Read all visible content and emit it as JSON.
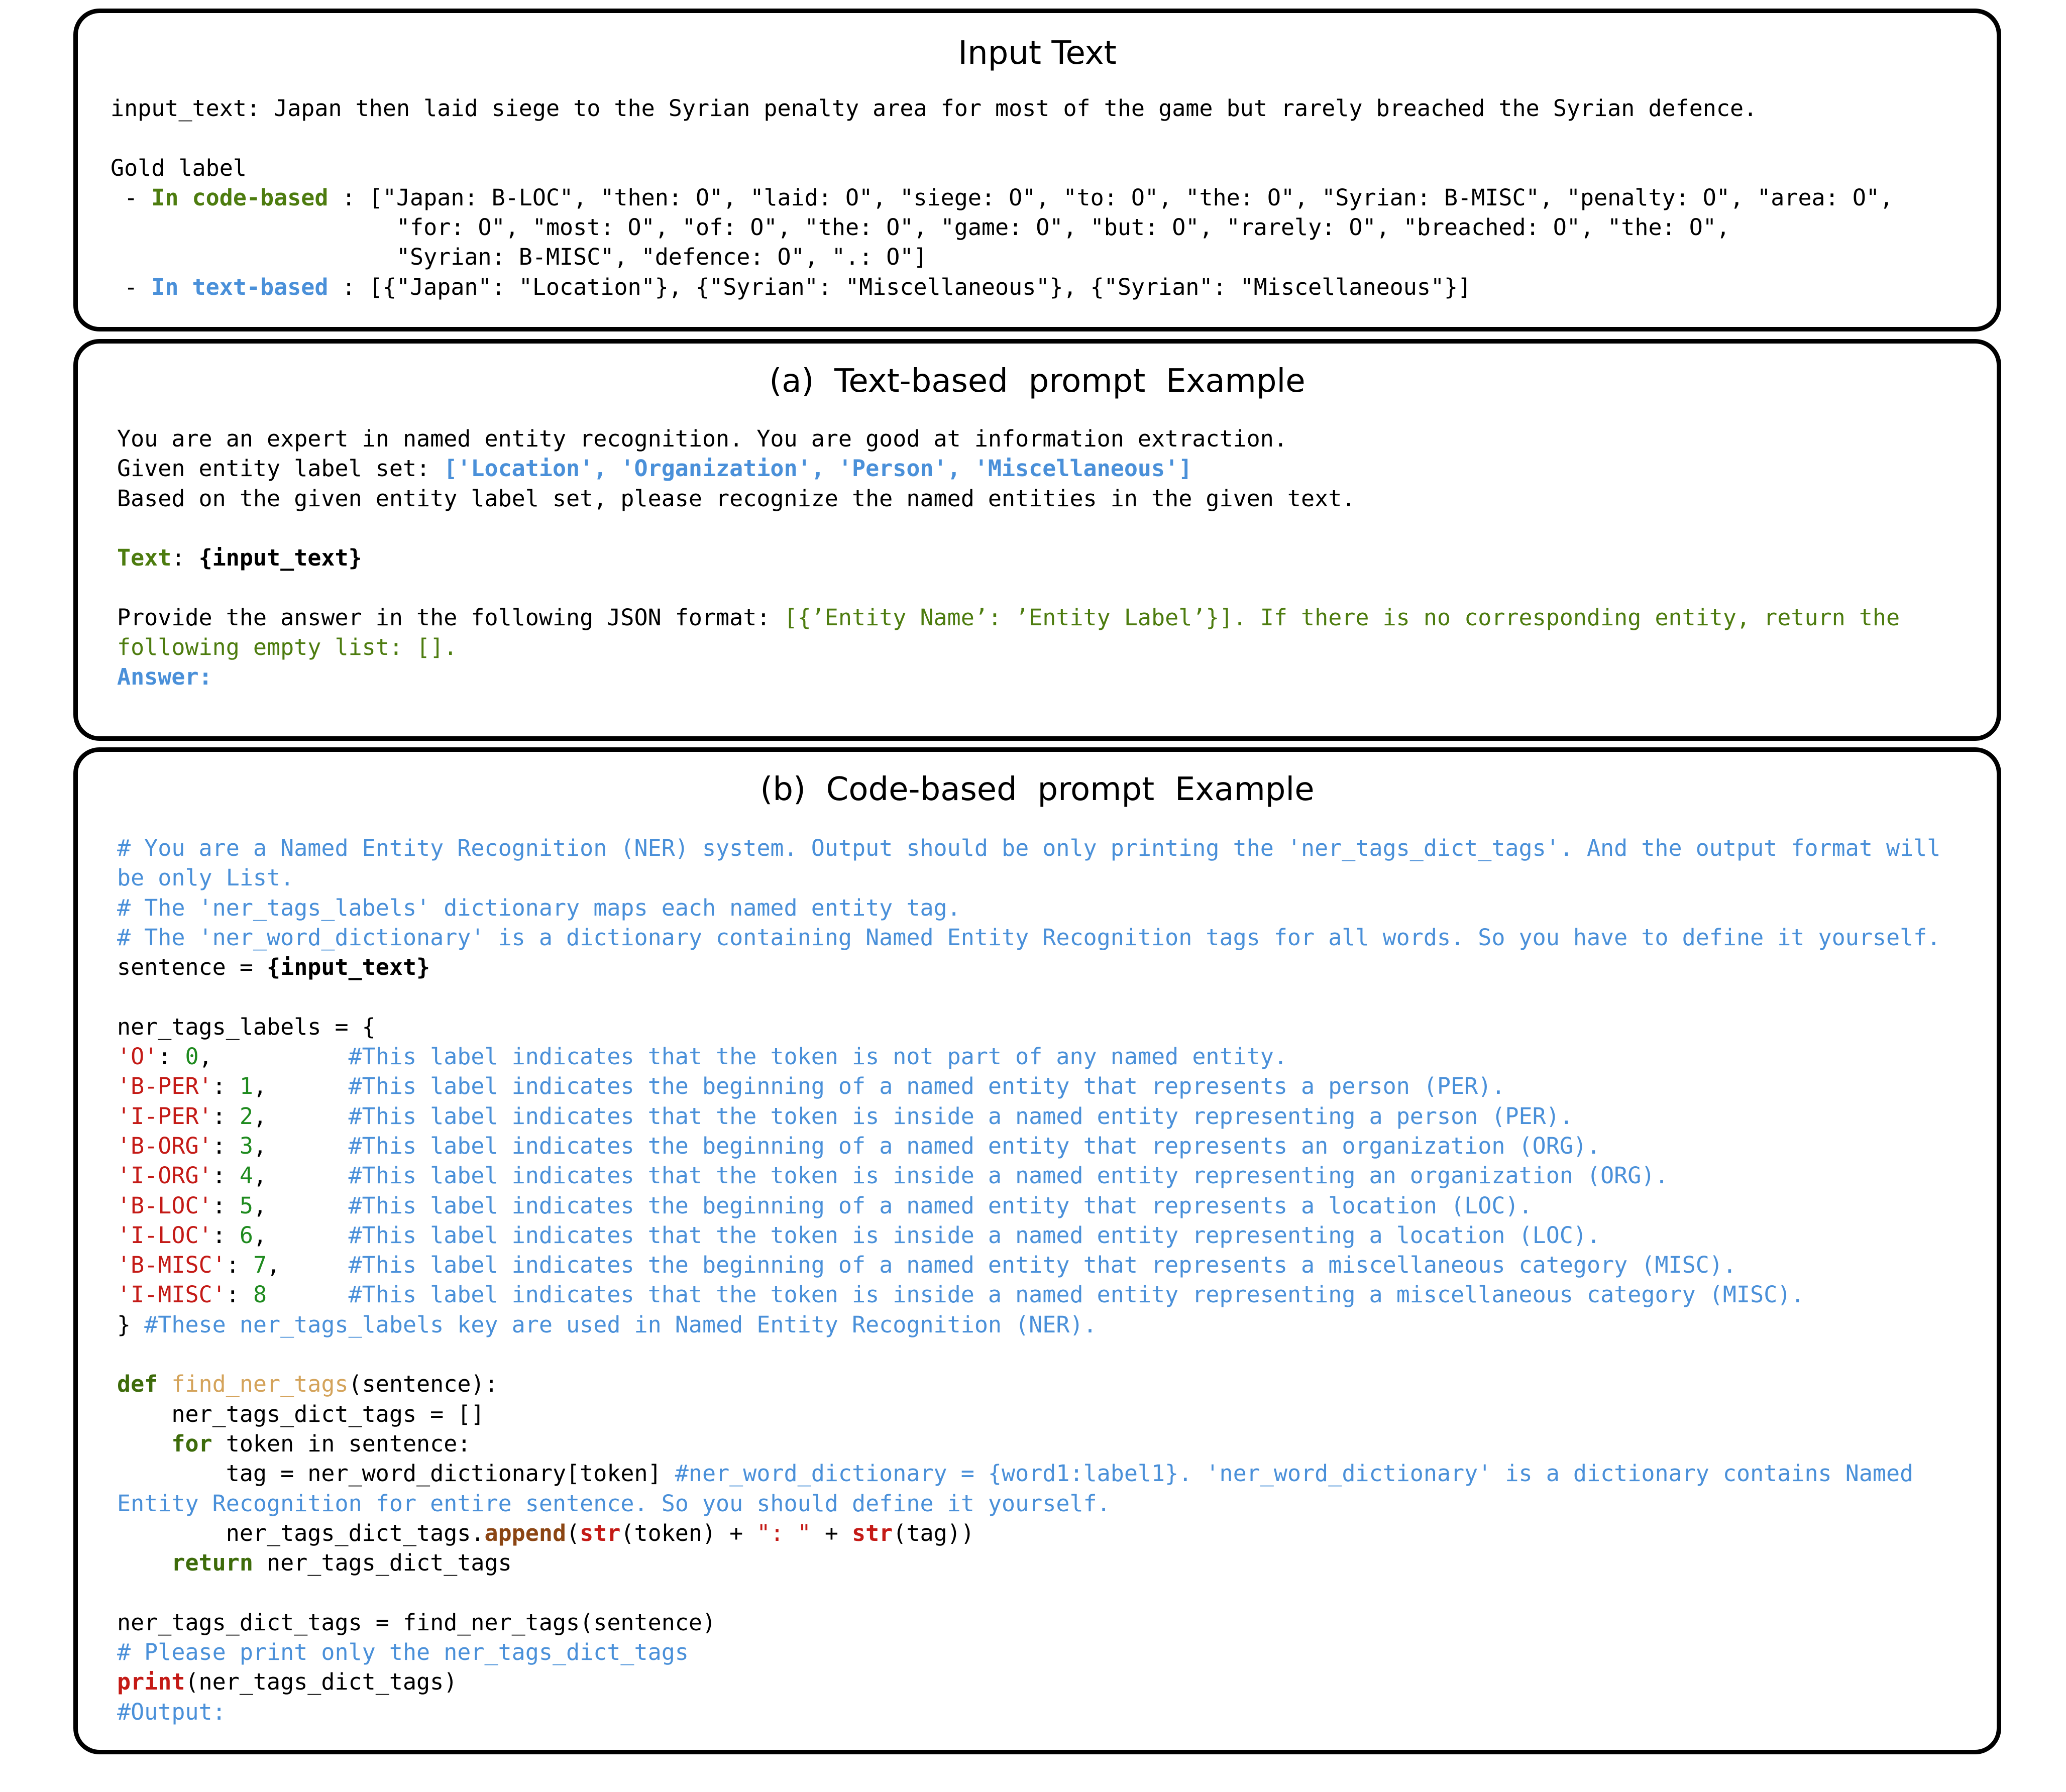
{
  "input_panel": {
    "title": "Input Text",
    "input_text_label": "input_text:",
    "input_text_value": "Japan then laid siege to the Syrian penalty area for most of the game but rarely breached the Syrian defence.",
    "gold_label": "Gold label",
    "code_bullet_dash": " - ",
    "code_based_label": "In code-based",
    "code_tags_line1": " : [\"Japan: B-LOC\", \"then: O\", \"laid: O\", \"siege: O\", \"to: O\", \"the: O\", \"Syrian: B-MISC\", \"penalty: O\", \"area: O\",",
    "code_tags_line2": "\"for: O\", \"most: O\", \"of: O\", \"the: O\", \"game: O\", \"but: O\", \"rarely: O\", \"breached: O\", \"the: O\",",
    "code_tags_line3": "\"Syrian: B-MISC\", \"defence: O\", \".: O\"]",
    "text_bullet_dash": " - ",
    "text_based_label": "In text-based",
    "text_tags": " : [{\"Japan\": \"Location\"}, {\"Syrian\": \"Miscellaneous\"}, {\"Syrian\": \"Miscellaneous\"}]"
  },
  "text_prompt_panel": {
    "title": "(a)  Text-based  prompt  Example",
    "line1": "You are an expert in named entity recognition. You are good at information extraction.",
    "line2_prefix": "Given entity label set: ",
    "label_set": "['Location', 'Organization', 'Person', 'Miscellaneous']",
    "line3": "Based on the given entity label set, please recognize the named entities in the given text.",
    "text_key": "Text",
    "text_colon": ": ",
    "text_placeholder": "{input_text}",
    "format_prefix": "Provide the answer in the following JSON format: ",
    "format_line1_rest": "[{’Entity Name’: ’Entity Label’}]. If there is no corresponding entity, return the",
    "format_line2": "following empty list: [].",
    "answer_label": "Answer:"
  },
  "code_prompt_panel": {
    "title": "(b)  Code-based  prompt  Example",
    "comment1a": "# You are a Named Entity Recognition (NER) system. Output should be only printing the 'ner_tags_dict_tags'. And the output format will",
    "comment1b": "be only List.",
    "comment2": "# The 'ner_tags_labels' dictionary maps each named entity tag.",
    "comment3": "# The 'ner_word_dictionary' is a dictionary containing Named Entity Recognition tags for all words. So you have to define it yourself.",
    "sentence_prefix": "sentence = ",
    "sentence_placeholder": "{input_text}",
    "dict_open": "ner_tags_labels = {",
    "labels": [
      {
        "key": "'O'",
        "sep": ": ",
        "val": "0",
        "after": ",",
        "pad": "          ",
        "comment": "#This label indicates that the token is not part of any named entity."
      },
      {
        "key": "'B-PER'",
        "sep": ": ",
        "val": "1",
        "after": ",",
        "pad": "      ",
        "comment": "#This label indicates the beginning of a named entity that represents a person (PER)."
      },
      {
        "key": "'I-PER'",
        "sep": ": ",
        "val": "2",
        "after": ",",
        "pad": "      ",
        "comment": "#This label indicates that the token is inside a named entity representing a person (PER)."
      },
      {
        "key": "'B-ORG'",
        "sep": ": ",
        "val": "3",
        "after": ",",
        "pad": "      ",
        "comment": "#This label indicates the beginning of a named entity that represents an organization (ORG)."
      },
      {
        "key": "'I-ORG'",
        "sep": ": ",
        "val": "4",
        "after": ",",
        "pad": "      ",
        "comment": "#This label indicates that the token is inside a named entity representing an organization (ORG)."
      },
      {
        "key": "'B-LOC'",
        "sep": ": ",
        "val": "5",
        "after": ",",
        "pad": "      ",
        "comment": "#This label indicates the beginning of a named entity that represents a location (LOC)."
      },
      {
        "key": "'I-LOC'",
        "sep": ": ",
        "val": "6",
        "after": ",",
        "pad": "      ",
        "comment": "#This label indicates that the token is inside a named entity representing a location (LOC)."
      },
      {
        "key": "'B-MISC'",
        "sep": ": ",
        "val": "7",
        "after": ",",
        "pad": "     ",
        "comment": "#This label indicates the beginning of a named entity that represents a miscellaneous category (MISC)."
      },
      {
        "key": "'I-MISC'",
        "sep": ": ",
        "val": "8",
        "after": "",
        "pad": "      ",
        "comment": "#This label indicates that the token is inside a named entity representing a miscellaneous category (MISC)."
      }
    ],
    "dict_close": "} ",
    "dict_close_comment": "#These ner_tags_labels key are used in Named Entity Recognition (NER).",
    "def_kw": "def",
    "func_name": "find_ner_tags",
    "def_rest": "(sentence):",
    "init_line": "    ner_tags_dict_tags = []",
    "for_indent": "    ",
    "for_kw": "for",
    "for_rest": " token in sentence:",
    "tag_line": "        tag = ner_word_dictionary[token] ",
    "tag_comment_a": "#ner_word_dictionary = {word1:label1}. 'ner_word_dictionary' is a dictionary contains Named",
    "tag_comment_b": "Entity Recognition for entire sentence. So you should define it yourself.",
    "append_prefix": "        ner_tags_dict_tags.",
    "append_method": "append",
    "append_open": "(",
    "str_kw": "str",
    "append_tok": "(token) + ",
    "append_string": "\": \"",
    "append_plus": " + ",
    "append_tag": "(tag))",
    "return_indent": "    ",
    "return_kw": "return",
    "return_rest": " ner_tags_dict_tags",
    "call_line": "ner_tags_dict_tags = find_ner_tags(sentence)",
    "print_comment": "# Please print only the ner_tags_dict_tags",
    "print_kw": "print",
    "print_rest": "(ner_tags_dict_tags)",
    "output_comment": "#Output:"
  }
}
